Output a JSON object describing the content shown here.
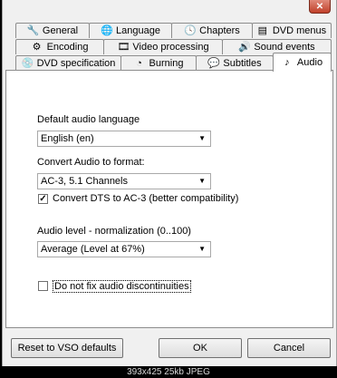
{
  "window": {
    "close_glyph": "✕"
  },
  "tabs": {
    "row1": [
      {
        "label": "General",
        "icon": "wrench-icon"
      },
      {
        "label": "Language",
        "icon": "globe-icon"
      },
      {
        "label": "Chapters",
        "icon": "clock-icon"
      },
      {
        "label": "DVD menus",
        "icon": "menu-icon"
      }
    ],
    "row2": [
      {
        "label": "Encoding",
        "icon": "gear-icon"
      },
      {
        "label": "Video processing",
        "icon": "film-icon"
      },
      {
        "label": "Sound events",
        "icon": "sound-icon"
      }
    ],
    "row3": [
      {
        "label": "DVD specification",
        "icon": "disc-icon"
      },
      {
        "label": "Burning",
        "icon": "burn-icon"
      },
      {
        "label": "Subtitles",
        "icon": "subtitle-icon"
      },
      {
        "label": "Audio",
        "icon": "music-note-icon"
      }
    ]
  },
  "audio": {
    "default_language_label": "Default audio language",
    "default_language_value": "English (en)",
    "convert_label": "Convert Audio to format:",
    "convert_value": "AC-3, 5.1 Channels",
    "convert_dts_label": "Convert DTS to AC-3 (better compatibility)",
    "convert_dts_checked": true,
    "level_label": "Audio level - normalization (0..100)",
    "level_value": "Average (Level at 67%)",
    "no_fix_label": "Do not fix audio discontinuities",
    "no_fix_checked": false
  },
  "buttons": {
    "reset": "Reset to VSO defaults",
    "ok": "OK",
    "cancel": "Cancel"
  },
  "caption": "393x425 25kb JPEG",
  "colors": {
    "tab_border": "#8d8d8d",
    "panel_bg": "#ffffff",
    "window_bg": "#f0f0f0"
  }
}
